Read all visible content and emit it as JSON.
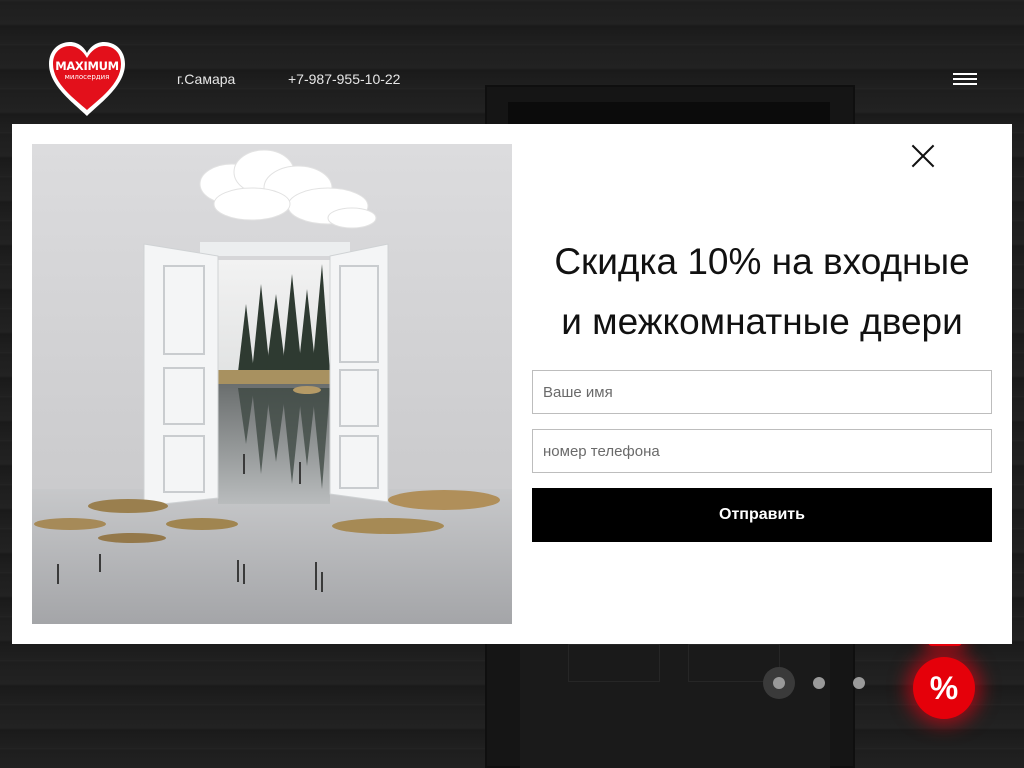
{
  "header": {
    "logo": {
      "title": "MAXIMUM",
      "subtitle": "милосердия"
    },
    "city": "г.Самара",
    "phone": "+7-987-955-10-22",
    "menu_icon": "hamburger-icon"
  },
  "modal": {
    "title_line1": "Скидка 10% на входные",
    "title_line2": "и межкомнатные двери",
    "name_placeholder": "Ваше имя",
    "phone_placeholder": "номер телефона",
    "submit_label": "Отправить",
    "close_icon": "close-icon",
    "image_icon": "door-landscape-image"
  },
  "slider": {
    "total": 3,
    "active": 1
  },
  "promo": {
    "label": "%",
    "icon": "percent-icon"
  },
  "colors": {
    "accent": "#e5000a",
    "button": "#000000",
    "modal_bg": "#ffffff"
  }
}
